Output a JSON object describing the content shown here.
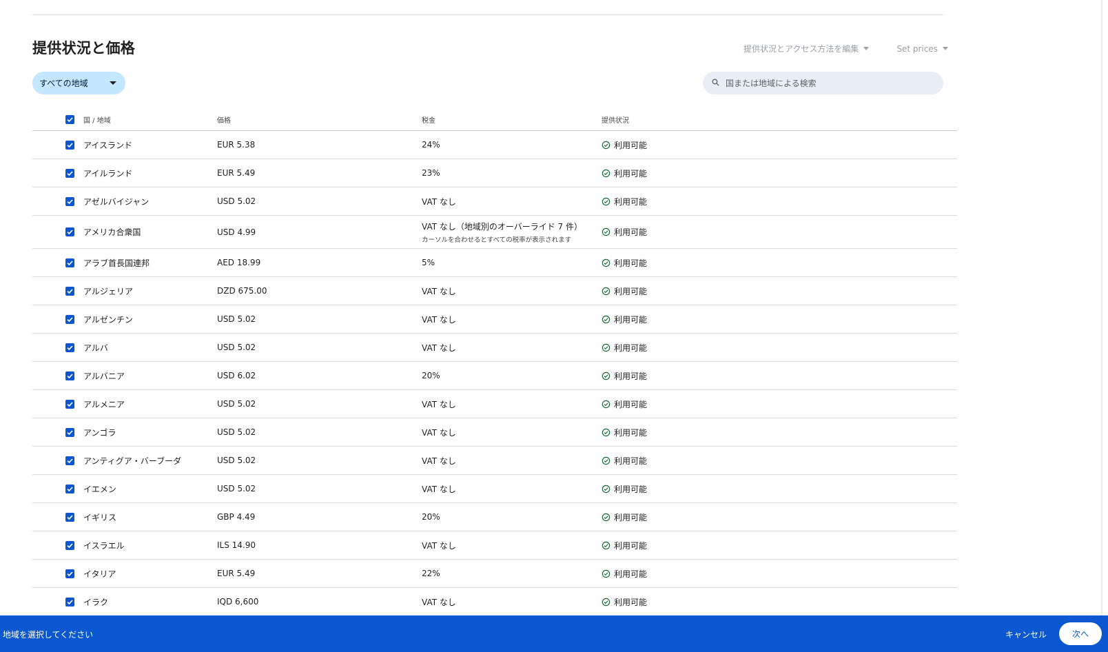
{
  "section": {
    "title": "提供状況と価格",
    "edit_availability_label": "提供状況とアクセス方法を編集",
    "set_prices_label": "Set prices"
  },
  "filter": {
    "label": "すべての地域"
  },
  "search": {
    "placeholder": "国または地域による検索"
  },
  "table": {
    "headers": {
      "country": "国 / 地域",
      "price": "価格",
      "tax": "税金",
      "status": "提供状況"
    },
    "rows": [
      {
        "country": "アイスランド",
        "price": "EUR 5.38",
        "tax": "24%",
        "status": "利用可能"
      },
      {
        "country": "アイルランド",
        "price": "EUR 5.49",
        "tax": "23%",
        "status": "利用可能"
      },
      {
        "country": "アゼルバイジャン",
        "price": "USD 5.02",
        "tax": "VAT なし",
        "status": "利用可能"
      },
      {
        "country": "アメリカ合衆国",
        "price": "USD 4.99",
        "tax": "VAT なし（地域別のオーバーライド 7 件）",
        "tax_sub": "カーソルを合わせるとすべての税率が表示されます",
        "status": "利用可能"
      },
      {
        "country": "アラブ首長国連邦",
        "price": "AED 18.99",
        "tax": "5%",
        "status": "利用可能"
      },
      {
        "country": "アルジェリア",
        "price": "DZD 675.00",
        "tax": "VAT なし",
        "status": "利用可能"
      },
      {
        "country": "アルゼンチン",
        "price": "USD 5.02",
        "tax": "VAT なし",
        "status": "利用可能"
      },
      {
        "country": "アルバ",
        "price": "USD 5.02",
        "tax": "VAT なし",
        "status": "利用可能"
      },
      {
        "country": "アルバニア",
        "price": "USD 6.02",
        "tax": "20%",
        "status": "利用可能"
      },
      {
        "country": "アルメニア",
        "price": "USD 5.02",
        "tax": "VAT なし",
        "status": "利用可能"
      },
      {
        "country": "アンゴラ",
        "price": "USD 5.02",
        "tax": "VAT なし",
        "status": "利用可能"
      },
      {
        "country": "アンティグア・バーブーダ",
        "price": "USD 5.02",
        "tax": "VAT なし",
        "status": "利用可能"
      },
      {
        "country": "イエメン",
        "price": "USD 5.02",
        "tax": "VAT なし",
        "status": "利用可能"
      },
      {
        "country": "イギリス",
        "price": "GBP 4.49",
        "tax": "20%",
        "status": "利用可能"
      },
      {
        "country": "イスラエル",
        "price": "ILS 14.90",
        "tax": "VAT なし",
        "status": "利用可能"
      },
      {
        "country": "イタリア",
        "price": "EUR 5.49",
        "tax": "22%",
        "status": "利用可能"
      },
      {
        "country": "イラク",
        "price": "IQD 6,600",
        "tax": "VAT なし",
        "status": "利用可能"
      }
    ]
  },
  "footer": {
    "message": "/ 地域を選択してください",
    "cancel_label": "キャンセル",
    "next_label": "次へ"
  },
  "colors": {
    "accent": "#0b57d0",
    "chip": "#c2e7ff",
    "status_ok": "#146c2e"
  }
}
